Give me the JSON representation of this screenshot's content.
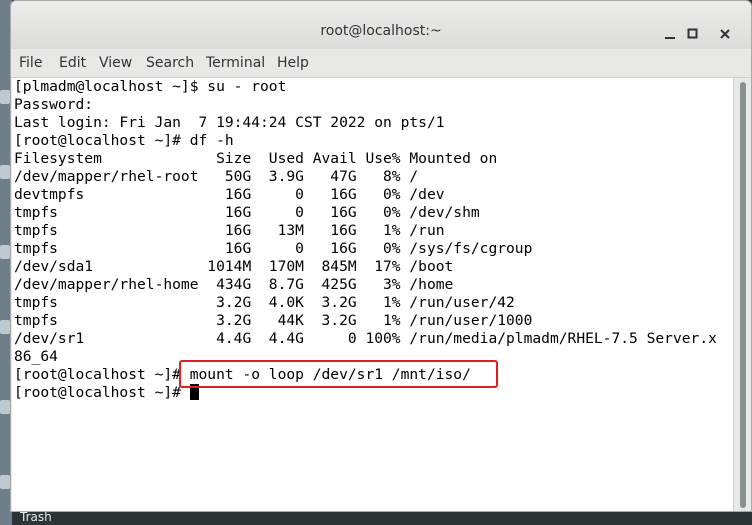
{
  "window": {
    "title": "root@localhost:~"
  },
  "titlebar_buttons": {
    "minimize": "—",
    "maximize": "☐",
    "close": "✕"
  },
  "menu": [
    "File",
    "Edit",
    "View",
    "Search",
    "Terminal",
    "Help"
  ],
  "terminal_lines": [
    "[plmadm@localhost ~]$ su - root",
    "Password:",
    "Last login: Fri Jan  7 19:44:24 CST 2022 on pts/1",
    "[root@localhost ~]# df -h",
    "Filesystem             Size  Used Avail Use% Mounted on",
    "/dev/mapper/rhel-root   50G  3.9G   47G   8% /",
    "devtmpfs                16G     0   16G   0% /dev",
    "tmpfs                   16G     0   16G   0% /dev/shm",
    "tmpfs                   16G   13M   16G   1% /run",
    "tmpfs                   16G     0   16G   0% /sys/fs/cgroup",
    "/dev/sda1             1014M  170M  845M  17% /boot",
    "/dev/mapper/rhel-home  434G  8.7G  425G   3% /home",
    "tmpfs                  3.2G  4.0K  3.2G   1% /run/user/42",
    "tmpfs                  3.2G   44K  3.2G   1% /run/user/1000",
    "/dev/sr1               4.4G  4.4G     0 100% /run/media/plmadm/RHEL-7.5 Server.x",
    "86_64",
    "[root@localhost ~]# mount -o loop /dev/sr1 /mnt/iso/",
    "[root@localhost ~]# "
  ],
  "desktop": {
    "trash_label": "Trash"
  },
  "colors": {
    "highlight": "#e02020",
    "terminal_bg": "#ffffff",
    "terminal_fg": "#000000"
  }
}
